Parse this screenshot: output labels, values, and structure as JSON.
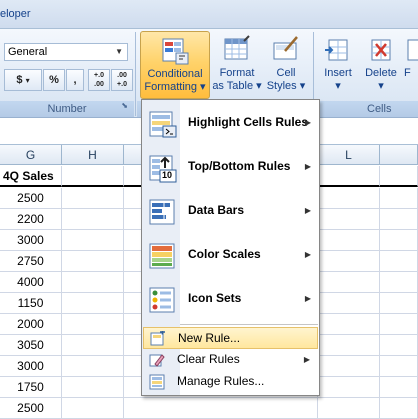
{
  "tabstrip": {
    "partial_tab": "eloper"
  },
  "number_group": {
    "format_value": "General",
    "currency": "$",
    "percent": "%",
    "comma": ",",
    "inc_decimal": "+.0 .00",
    "dec_decimal": ".00 +.0",
    "label": "Number"
  },
  "styles_group": {
    "conditional_formatting": [
      "Conditional",
      "Formatting ▾"
    ],
    "format_as_table": [
      "Format",
      "as Table ▾"
    ],
    "cell_styles": [
      "Cell",
      "Styles ▾"
    ]
  },
  "cells_group": {
    "insert": "Insert",
    "delete": "Delete",
    "format_partial": "F",
    "label": "Cells"
  },
  "grid": {
    "columns": [
      "G",
      "H",
      "L"
    ],
    "header_cell": "4Q Sales",
    "values": [
      "2500",
      "2200",
      "3000",
      "2750",
      "4000",
      "1150",
      "2000",
      "3050",
      "3000",
      "1750",
      "2500"
    ]
  },
  "menu": {
    "items": [
      {
        "label": "Highlight Cells Rules",
        "icon": "highlight-cells-rules-icon",
        "submenu": true
      },
      {
        "label": "Top/Bottom Rules",
        "icon": "top-bottom-rules-icon",
        "submenu": true
      },
      {
        "label": "Data Bars",
        "icon": "data-bars-icon",
        "submenu": true
      },
      {
        "label": "Color Scales",
        "icon": "color-scales-icon",
        "submenu": true
      },
      {
        "label": "Icon Sets",
        "icon": "icon-sets-icon",
        "submenu": true
      }
    ],
    "actions": [
      {
        "label": "New Rule...",
        "icon": "new-rule-icon",
        "highlighted": true
      },
      {
        "label": "Clear Rules",
        "icon": "clear-rules-icon",
        "submenu": true
      },
      {
        "label": "Manage Rules...",
        "icon": "manage-rules-icon"
      }
    ],
    "top10_badge": "10",
    "submenu_arrow": "▶"
  }
}
